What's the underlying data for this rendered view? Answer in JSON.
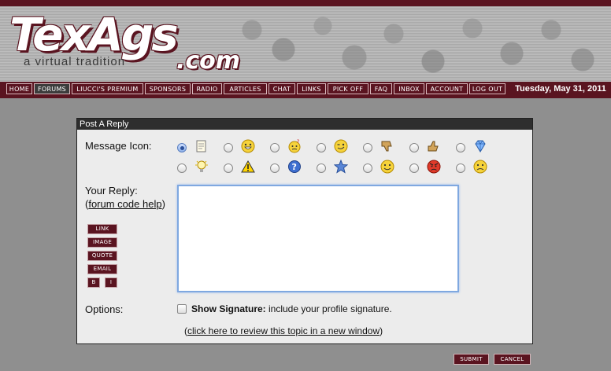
{
  "header": {
    "logo_main": "TexAgs",
    "logo_com": ".com",
    "tagline": "a virtual tradition",
    "date": "Tuesday, May 31, 2011"
  },
  "nav": {
    "items": [
      {
        "label": "HOME"
      },
      {
        "label": "FORUMS",
        "active": true
      },
      {
        "label": "LIUCCI'S PREMIUM"
      },
      {
        "label": "SPONSORS"
      },
      {
        "label": "RADIO"
      },
      {
        "label": "ARTICLES"
      },
      {
        "label": "CHAT"
      },
      {
        "label": "LINKS"
      },
      {
        "label": "PICK OFF"
      },
      {
        "label": "FAQ"
      },
      {
        "label": "INBOX"
      },
      {
        "label": "ACCOUNT"
      },
      {
        "label": "LOG OUT"
      }
    ]
  },
  "panel": {
    "title": "Post A Reply",
    "message_icon_label": "Message Icon:",
    "selected_icon": "note",
    "icons": [
      "note-icon",
      "grin-icon",
      "confused-icon",
      "wink-icon",
      "thumbs-down-icon",
      "thumbs-up-icon",
      "gem-icon",
      "lightbulb-icon",
      "warning-icon",
      "question-icon",
      "star-icon",
      "smile-icon",
      "angry-icon",
      "frown-icon"
    ],
    "reply_label": "Your Reply:",
    "help_open": "(",
    "help_link": "forum code help",
    "help_close": ")",
    "format_buttons": {
      "link": "LINK",
      "image": "IMAGE",
      "quote": "QUOTE",
      "email": "EMAIL",
      "bold": "B",
      "italic": "I"
    },
    "reply_value": "",
    "options_label": "Options:",
    "signature_strong": "Show Signature:",
    "signature_text": " include your profile signature.",
    "signature_checked": false,
    "review_open": "(",
    "review_link": "click here to review this topic in a new window",
    "review_close": ")"
  },
  "actions": {
    "submit": "SUBMIT",
    "cancel": "CANCEL"
  },
  "colors": {
    "maroon": "#5a1420",
    "panel_bg": "#ececec",
    "page_bg": "#8f8f8f"
  }
}
